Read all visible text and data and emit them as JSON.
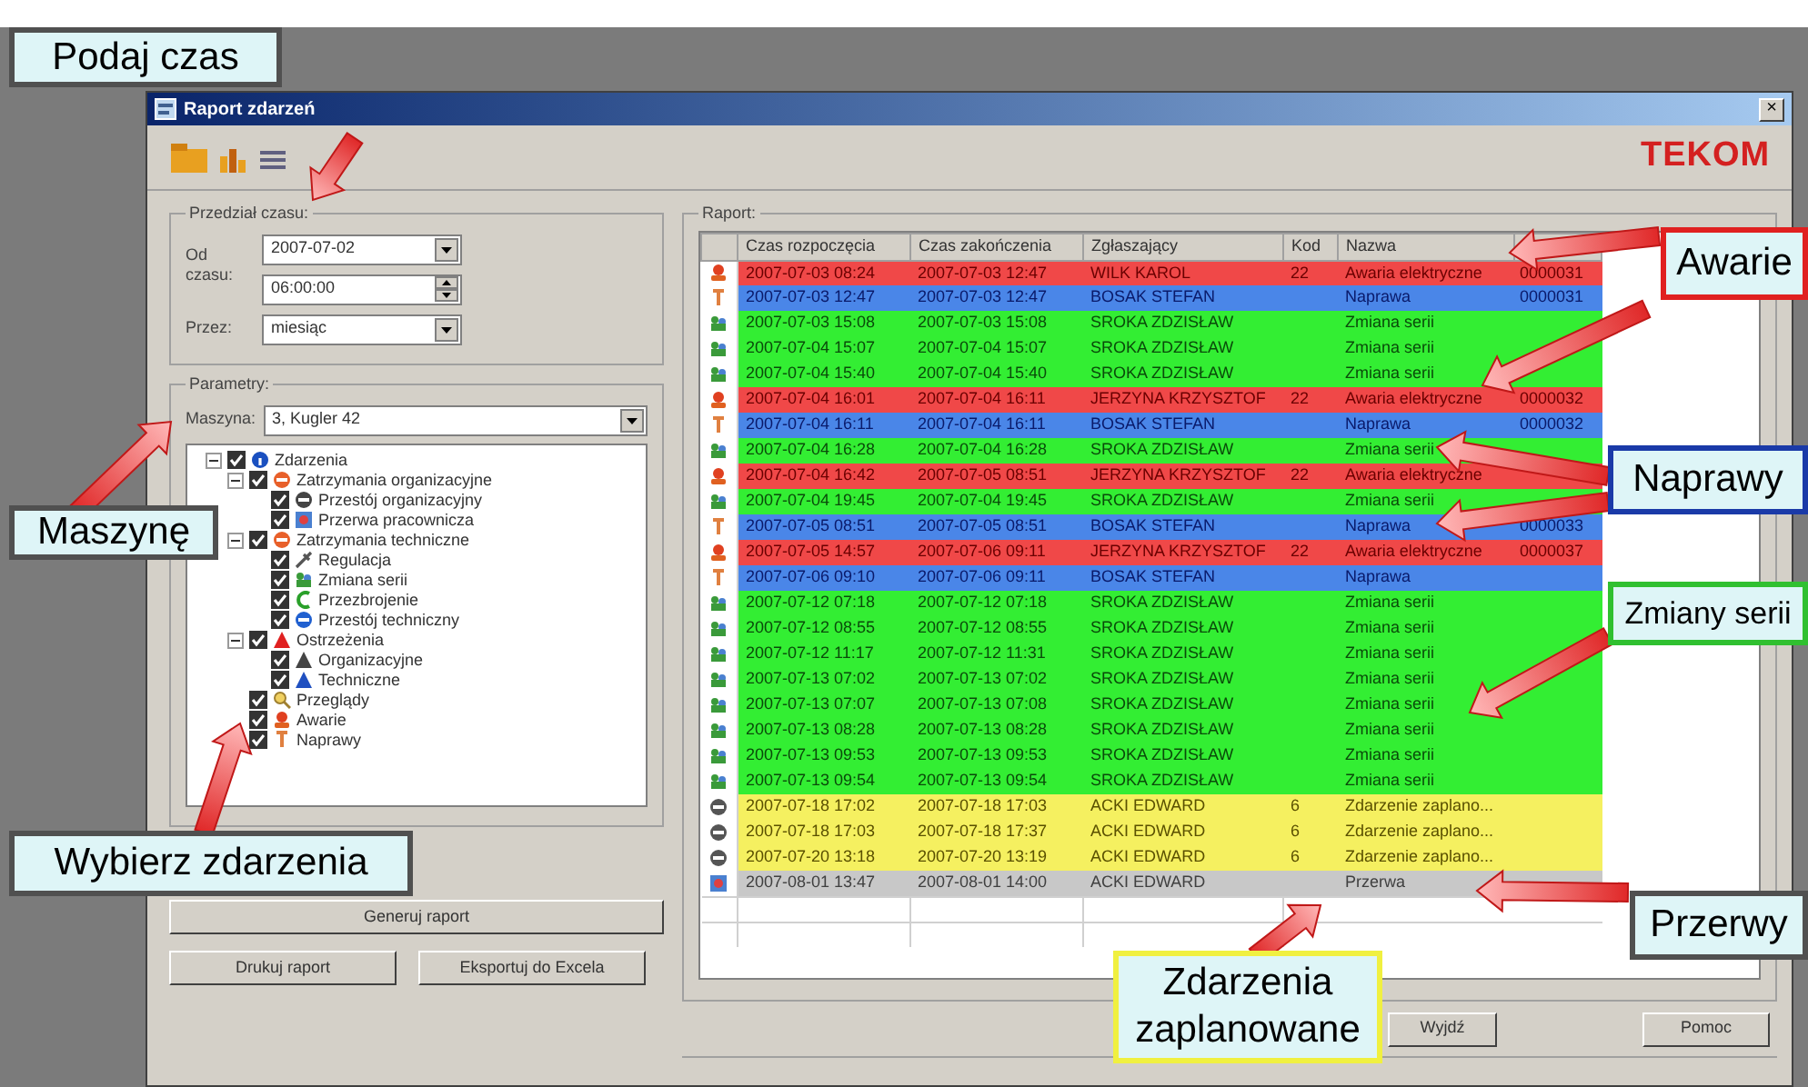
{
  "window": {
    "title": "Raport zdarzeń",
    "close": "×"
  },
  "toolbar": {
    "logo": "TEKOM"
  },
  "time_range": {
    "label": "Przedział czasu:",
    "from_label": "Od czasu:",
    "date": "2007-07-02",
    "time": "06:00:00",
    "period_label": "Przez:",
    "period": "miesiąc"
  },
  "parameters": {
    "label": "Parametry:",
    "machine_label": "Maszyna:",
    "machine": "3, Kugler 42"
  },
  "tree": [
    {
      "label": "Zdarzenia",
      "kind": "events",
      "checked": true,
      "expanded": true,
      "children": [
        {
          "label": "Zatrzymania organizacyjne",
          "kind": "stop",
          "checked": true,
          "expanded": true,
          "children": [
            {
              "label": "Przestój organizacyjny",
              "kind": "dark_stop",
              "checked": true
            },
            {
              "label": "Przerwa pracownicza",
              "kind": "break",
              "checked": true
            }
          ]
        },
        {
          "label": "Zatrzymania techniczne",
          "kind": "stop",
          "checked": true,
          "expanded": true,
          "children": [
            {
              "label": "Regulacja",
              "kind": "wrench",
              "checked": true
            },
            {
              "label": "Zmiana serii",
              "kind": "people",
              "checked": true
            },
            {
              "label": "Przezbrojenie",
              "kind": "hook",
              "checked": true
            },
            {
              "label": "Przestój techniczny",
              "kind": "blue_stop",
              "checked": true
            }
          ]
        },
        {
          "label": "Ostrzeżenia",
          "kind": "warning",
          "checked": true,
          "expanded": true,
          "children": [
            {
              "label": "Organizacyjne",
              "kind": "dark_warning",
              "checked": true
            },
            {
              "label": "Techniczne",
              "kind": "blue_warning",
              "checked": true
            }
          ]
        },
        {
          "label": "Przeglądy",
          "kind": "inspection",
          "checked": true
        },
        {
          "label": "Awarie",
          "kind": "failure",
          "checked": true
        },
        {
          "label": "Naprawy",
          "kind": "repair",
          "checked": true
        }
      ]
    }
  ],
  "left_buttons": [
    "Generuj raport",
    "Drukuj raport",
    "Eksportuj do Excela"
  ],
  "report": {
    "label": "Raport:",
    "columns": [
      "Czas rozpoczęcia",
      "Czas zakończenia",
      "Zgłaszający",
      "Kod",
      "Nazwa"
    ],
    "rows": [
      {
        "kind": "failure",
        "color": "#f04848",
        "start": "2007-07-03 08:24",
        "end": "2007-07-03 12:47",
        "reporter": "WILK KAROL",
        "code": "22",
        "name": "Awaria elektryczne",
        "column_7": "0000031"
      },
      {
        "kind": "repair",
        "color": "#4a86e8",
        "start": "2007-07-03 12:47",
        "end": "2007-07-03 12:47",
        "reporter": "BOSAK STEFAN",
        "name": "Naprawa",
        "column_7": "0000031"
      },
      {
        "kind": "series_change",
        "color": "#33ee33",
        "start": "2007-07-03 15:08",
        "end": "2007-07-03 15:08",
        "reporter": "SROKA ZDZISŁAW",
        "name": "Zmiana serii"
      },
      {
        "kind": "series_change",
        "color": "#33ee33",
        "start": "2007-07-04 15:07",
        "end": "2007-07-04 15:07",
        "reporter": "SROKA ZDZISŁAW",
        "name": "Zmiana serii"
      },
      {
        "kind": "series_change",
        "color": "#33ee33",
        "start": "2007-07-04 15:40",
        "end": "2007-07-04 15:40",
        "reporter": "SROKA ZDZISŁAW",
        "name": "Zmiana serii"
      },
      {
        "kind": "failure",
        "color": "#f04848",
        "start": "2007-07-04 16:01",
        "end": "2007-07-04 16:11",
        "reporter": "JERZYNA KRZYSZTOF",
        "code": "22",
        "name": "Awaria elektryczne",
        "column_7": "0000032"
      },
      {
        "kind": "repair",
        "color": "#4a86e8",
        "start": "2007-07-04 16:11",
        "end": "2007-07-04 16:11",
        "reporter": "BOSAK STEFAN",
        "name": "Naprawa",
        "column_7": "0000032"
      },
      {
        "kind": "series_change",
        "color": "#33ee33",
        "start": "2007-07-04 16:28",
        "end": "2007-07-04 16:28",
        "reporter": "SROKA ZDZISŁAW",
        "name": "Zmiana serii"
      },
      {
        "kind": "failure",
        "color": "#f04848",
        "start": "2007-07-04 16:42",
        "end": "2007-07-05 08:51",
        "reporter": "JERZYNA KRZYSZTOF",
        "code": "22",
        "name": "Awaria elektryczne"
      },
      {
        "kind": "series_change",
        "color": "#33ee33",
        "start": "2007-07-04 19:45",
        "end": "2007-07-04 19:45",
        "reporter": "SROKA ZDZISŁAW",
        "name": "Zmiana serii"
      },
      {
        "kind": "repair",
        "color": "#4a86e8",
        "start": "2007-07-05 08:51",
        "end": "2007-07-05 08:51",
        "reporter": "BOSAK STEFAN",
        "name": "Naprawa",
        "column_7": "0000033"
      },
      {
        "kind": "failure",
        "color": "#f04848",
        "start": "2007-07-05 14:57",
        "end": "2007-07-06 09:11",
        "reporter": "JERZYNA KRZYSZTOF",
        "code": "22",
        "name": "Awaria elektryczne",
        "column_7": "0000037"
      },
      {
        "kind": "repair",
        "color": "#4a86e8",
        "start": "2007-07-06 09:10",
        "end": "2007-07-06 09:11",
        "reporter": "BOSAK STEFAN",
        "name": "Naprawa"
      },
      {
        "kind": "series_change",
        "color": "#33ee33",
        "start": "2007-07-12 07:18",
        "end": "2007-07-12 07:18",
        "reporter": "SROKA ZDZISŁAW",
        "name": "Zmiana serii"
      },
      {
        "kind": "series_change",
        "color": "#33ee33",
        "start": "2007-07-12 08:55",
        "end": "2007-07-12 08:55",
        "reporter": "SROKA ZDZISŁAW",
        "name": "Zmiana serii"
      },
      {
        "kind": "series_change",
        "color": "#33ee33",
        "start": "2007-07-12 11:17",
        "end": "2007-07-12 11:31",
        "reporter": "SROKA ZDZISŁAW",
        "name": "Zmiana serii"
      },
      {
        "kind": "series_change",
        "color": "#33ee33",
        "start": "2007-07-13 07:02",
        "end": "2007-07-13 07:02",
        "reporter": "SROKA ZDZISŁAW",
        "name": "Zmiana serii"
      },
      {
        "kind": "series_change",
        "color": "#33ee33",
        "start": "2007-07-13 07:07",
        "end": "2007-07-13 07:08",
        "reporter": "SROKA ZDZISŁAW",
        "name": "Zmiana serii"
      },
      {
        "kind": "series_change",
        "color": "#33ee33",
        "start": "2007-07-13 08:28",
        "end": "2007-07-13 08:28",
        "reporter": "SROKA ZDZISŁAW",
        "name": "Zmiana serii"
      },
      {
        "kind": "series_change",
        "color": "#33ee33",
        "start": "2007-07-13 09:53",
        "end": "2007-07-13 09:53",
        "reporter": "SROKA ZDZISŁAW",
        "name": "Zmiana serii"
      },
      {
        "kind": "series_change",
        "color": "#33ee33",
        "start": "2007-07-13 09:54",
        "end": "2007-07-13 09:54",
        "reporter": "SROKA ZDZISŁAW",
        "name": "Zmiana serii"
      },
      {
        "kind": "planned",
        "color": "#f5f060",
        "start": "2007-07-18 17:02",
        "end": "2007-07-18 17:03",
        "reporter": "ACKI EDWARD",
        "code": "6",
        "name": "Zdarzenie zaplano..."
      },
      {
        "kind": "planned",
        "color": "#f5f060",
        "start": "2007-07-18 17:03",
        "end": "2007-07-18 17:37",
        "reporter": "ACKI EDWARD",
        "code": "6",
        "name": "Zdarzenie zaplano..."
      },
      {
        "kind": "planned",
        "color": "#f5f060",
        "start": "2007-07-20 13:18",
        "end": "2007-07-20 13:19",
        "reporter": "ACKI EDWARD",
        "code": "6",
        "name": "Zdarzenie zaplano..."
      },
      {
        "kind": "break",
        "color": "#c8c8c8",
        "start": "2007-08-01 13:47",
        "end": "2007-08-01 14:00",
        "reporter": "ACKI EDWARD",
        "name": "Przerwa"
      }
    ]
  },
  "bottom_buttons": [
    "Wyjdź",
    "Pomoc"
  ],
  "annotations": [
    {
      "text": "Podaj czas",
      "color": "#505050"
    },
    {
      "text": "Maszynę",
      "color": "#505050"
    },
    {
      "text": "Wybierz zdarzenia",
      "color": "#505050"
    },
    {
      "text": "Awarie",
      "color": "#e02020"
    },
    {
      "text": "Naprawy",
      "color": "#1a3aa8"
    },
    {
      "text": "Zmiany serii",
      "color": "#30c030"
    },
    {
      "text": "Przerwy",
      "color": "#505050"
    },
    {
      "text": "Zdarzenia zaplanowane",
      "color": "#f0f040"
    }
  ]
}
